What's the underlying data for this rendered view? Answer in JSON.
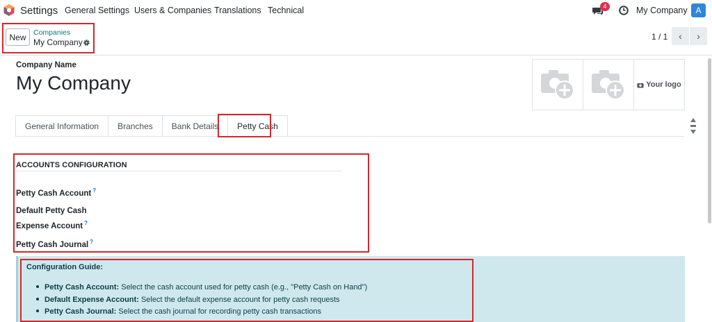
{
  "nav": {
    "app_name": "Settings",
    "menu": [
      "General Settings",
      "Users & Companies",
      "Translations",
      "Technical"
    ],
    "chat_badge": "4",
    "company": "My Company",
    "avatar_letter": "A"
  },
  "control": {
    "new_label": "New",
    "breadcrumb_parent": "Companies",
    "breadcrumb_current": "My Company",
    "pager": "1 / 1",
    "prev": "‹",
    "next": "›"
  },
  "form": {
    "company_name_label": "Company Name",
    "company_name": "My Company",
    "your_logo": "Your logo",
    "tabs": [
      "General Information",
      "Branches",
      "Bank Details",
      "Petty Cash"
    ],
    "active_tab": "Petty Cash",
    "section_title": "ACCOUNTS CONFIGURATION",
    "fields": {
      "petty_cash_account": "Petty Cash Account",
      "default_expense_line1": "Default Petty Cash",
      "default_expense_line2": "Expense Account",
      "petty_cash_journal": "Petty Cash Journal",
      "help_mark": "?"
    },
    "guide": {
      "title": "Configuration Guide:",
      "items": [
        {
          "label": "Petty Cash Account:",
          "text": " Select the cash account used for petty cash (e.g., \"Petty Cash on Hand\")"
        },
        {
          "label": "Default Expense Account:",
          "text": " Select the default expense account for petty cash requests"
        },
        {
          "label": "Petty Cash Journal:",
          "text": " Select the cash journal for recording petty cash transactions"
        }
      ]
    }
  },
  "colors": {
    "highlight_box": "#d2272c",
    "link": "#017e84",
    "guide_bg": "#cfe8ed",
    "badge": "#d9334f",
    "avatar": "#2e86de"
  },
  "icons": [
    "odoo-logo-icon",
    "chat-icon",
    "clock-icon",
    "gear-icon",
    "camera-add-icon",
    "scroll-arrows-icon"
  ]
}
